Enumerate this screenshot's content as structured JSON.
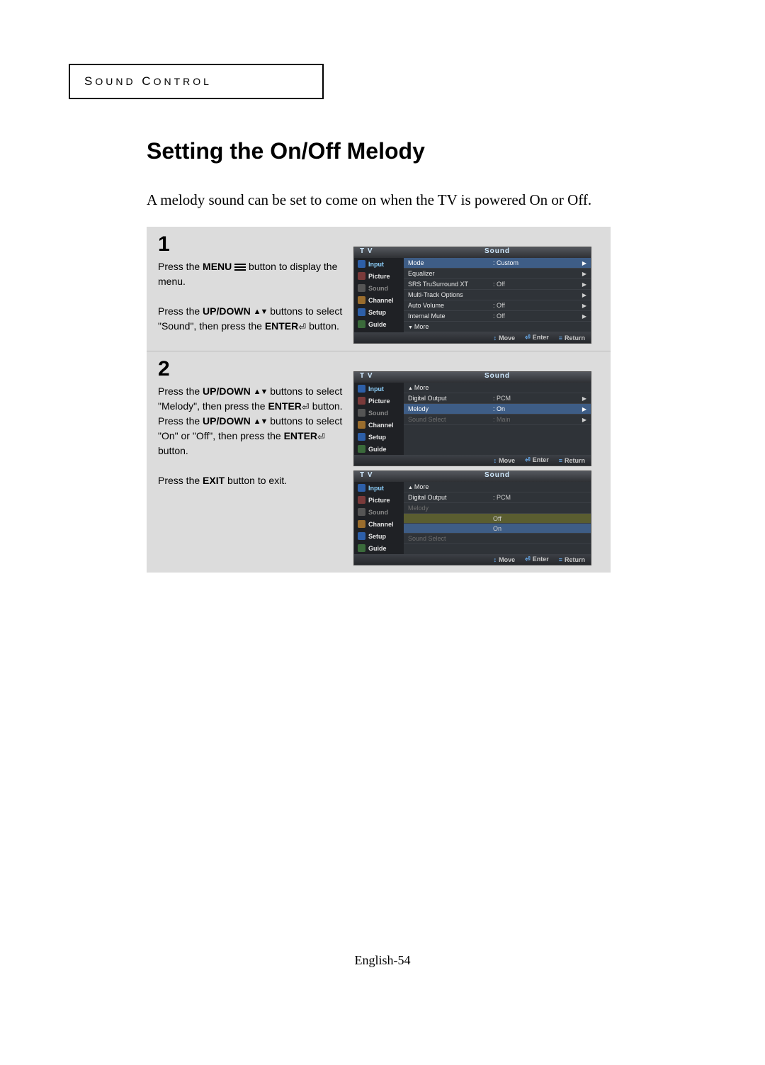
{
  "section_label": "SOUND CONTROL",
  "page_title": "Setting the On/Off Melody",
  "page_desc": "A melody sound can be set to come on when the TV is powered On or Off.",
  "steps": [
    {
      "num": "1",
      "lines": [
        {
          "pre": "Press the ",
          "b": "MENU",
          "icon": "menu",
          "post": " button to display the menu."
        },
        {
          "pre": "Press the ",
          "b": "UP/DOWN",
          "icon": "updown",
          "post": " buttons to select \"Sound\", then press the ",
          "b2": "ENTER",
          "icon2": "enter",
          "post2": " button."
        }
      ]
    },
    {
      "num": "2",
      "lines": [
        {
          "pre": "Press the ",
          "b": "UP/DOWN",
          "icon": "updown",
          "post": " buttons to select \"Melody\", then press the ",
          "b2": "ENTER",
          "icon2": "enter",
          "post2": " button. Press the ",
          "b3": "UP/DOWN",
          "icon3": "updown",
          "post3": " buttons to select \"On\" or \"Off\", then press the ",
          "b4": "ENTER",
          "icon4": "enter",
          "post4": " button."
        },
        {
          "pre": "Press the ",
          "b": "EXIT",
          "post": " button to exit."
        }
      ]
    }
  ],
  "osd_common": {
    "tv_label": "T V",
    "head_title": "Sound",
    "side": [
      {
        "label": "Input",
        "cls": "sel",
        "ico": "blue"
      },
      {
        "label": "Picture",
        "cls": "",
        "ico": "red"
      },
      {
        "label": "Sound",
        "cls": "dim",
        "ico": "gray"
      },
      {
        "label": "Channel",
        "cls": "",
        "ico": "orange"
      },
      {
        "label": "Setup",
        "cls": "",
        "ico": "blue"
      },
      {
        "label": "Guide",
        "cls": "",
        "ico": "green"
      }
    ],
    "foot": {
      "move": "Move",
      "enter": "Enter",
      "ret": "Return"
    }
  },
  "osd1_rows": [
    {
      "lbl": "Mode",
      "val": ": Custom",
      "hl": true,
      "arr": true
    },
    {
      "lbl": "Equalizer",
      "val": "",
      "arr": true
    },
    {
      "lbl": "SRS TruSurround XT",
      "val": ": Off",
      "arr": true
    },
    {
      "lbl": "Multi-Track Options",
      "val": "",
      "arr": true
    },
    {
      "lbl": "Auto Volume",
      "val": ": Off",
      "arr": true
    },
    {
      "lbl": "Internal Mute",
      "val": ": Off",
      "arr": true
    },
    {
      "lbl": "More",
      "val": "",
      "moredown": true
    }
  ],
  "osd2_rows": [
    {
      "lbl": "More",
      "val": "",
      "more": true
    },
    {
      "lbl": "Digital Output",
      "val": ": PCM",
      "arr": true
    },
    {
      "lbl": "Melody",
      "val": ": On",
      "hl": true,
      "arr": true
    },
    {
      "lbl": "Sound Select",
      "val": ": Main",
      "dim": true,
      "arr": true
    }
  ],
  "osd3_rows": [
    {
      "lbl": "More",
      "val": "",
      "more": true
    },
    {
      "lbl": "Digital Output",
      "val": ": PCM"
    },
    {
      "lbl": "Melody",
      "val": "",
      "dim": true
    },
    {
      "lbl": "",
      "val": "Off",
      "opt": true
    },
    {
      "lbl": "",
      "val": "On",
      "opt": true,
      "optsel": true
    },
    {
      "lbl": "Sound Select",
      "val": "",
      "dim": true
    }
  ],
  "footer": {
    "lang": "English-",
    "page": "54"
  }
}
